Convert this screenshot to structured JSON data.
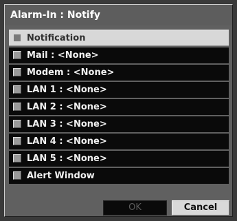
{
  "dialog": {
    "title": "Alarm-In : Notify"
  },
  "list": {
    "header_label": "Notification",
    "items": [
      {
        "label": "Mail : <None>",
        "checked": false
      },
      {
        "label": "Modem : <None>",
        "checked": false
      },
      {
        "label": "LAN 1 : <None>",
        "checked": false
      },
      {
        "label": "LAN 2 : <None>",
        "checked": false
      },
      {
        "label": "LAN 3 : <None>",
        "checked": false
      },
      {
        "label": "LAN 4 : <None>",
        "checked": false
      },
      {
        "label": "LAN 5 : <None>",
        "checked": false
      },
      {
        "label": "Alert Window",
        "checked": false
      }
    ]
  },
  "buttons": {
    "ok_label": "OK",
    "ok_enabled": false,
    "cancel_label": "Cancel"
  }
}
